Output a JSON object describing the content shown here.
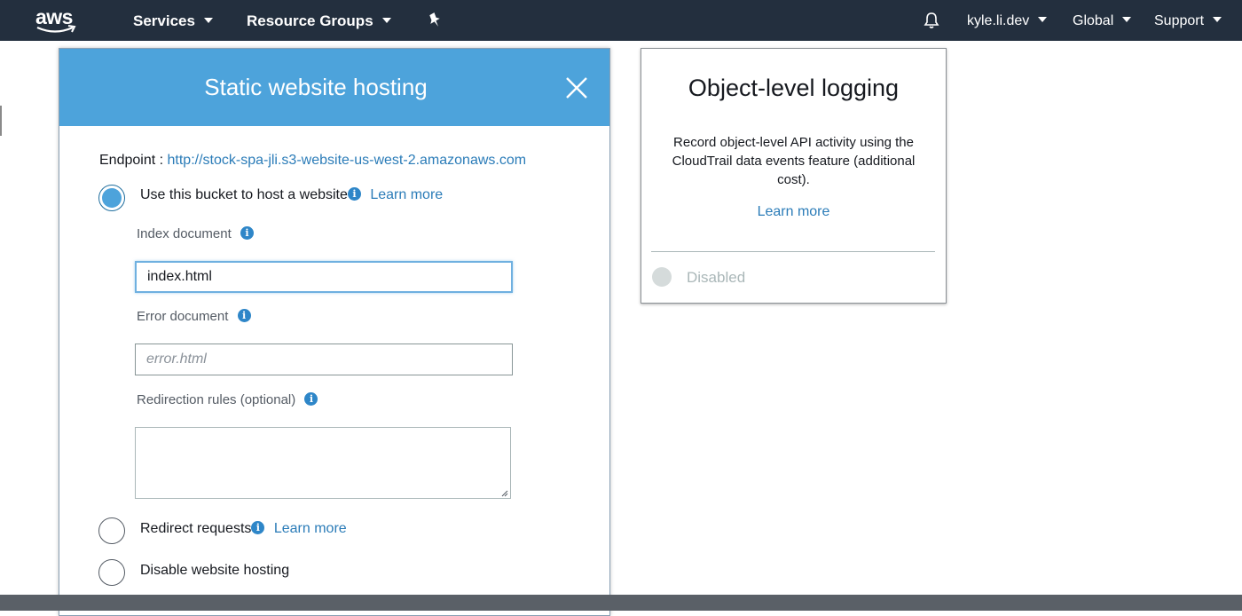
{
  "topnav": {
    "logo_text": "aws",
    "services_label": "Services",
    "resource_groups_label": "Resource Groups",
    "user_label": "kyle.li.dev",
    "region_label": "Global",
    "support_label": "Support"
  },
  "modal": {
    "title": "Static website hosting",
    "endpoint_label": "Endpoint : ",
    "endpoint_url": "http://stock-spa-jli.s3-website-us-west-2.amazonaws.com",
    "options": {
      "host": {
        "label": "Use this bucket to host a website",
        "learn_more": "Learn more",
        "checked": true
      },
      "redirect": {
        "label": "Redirect requests",
        "learn_more": "Learn more",
        "checked": false
      },
      "disable": {
        "label": "Disable website hosting",
        "checked": false
      }
    },
    "index_document": {
      "label": "Index document",
      "value": "index.html"
    },
    "error_document": {
      "label": "Error document",
      "placeholder": "error.html"
    },
    "redirection_rules": {
      "label": "Redirection rules (optional)"
    }
  },
  "card": {
    "title": "Object-level logging",
    "description": "Record object-level API activity using the CloudTrail data events feature (additional cost).",
    "learn_more": "Learn more",
    "status": "Disabled"
  },
  "colors": {
    "nav_bg": "#232f3e",
    "modal_header": "#4da3db",
    "link": "#2b7cb8"
  }
}
